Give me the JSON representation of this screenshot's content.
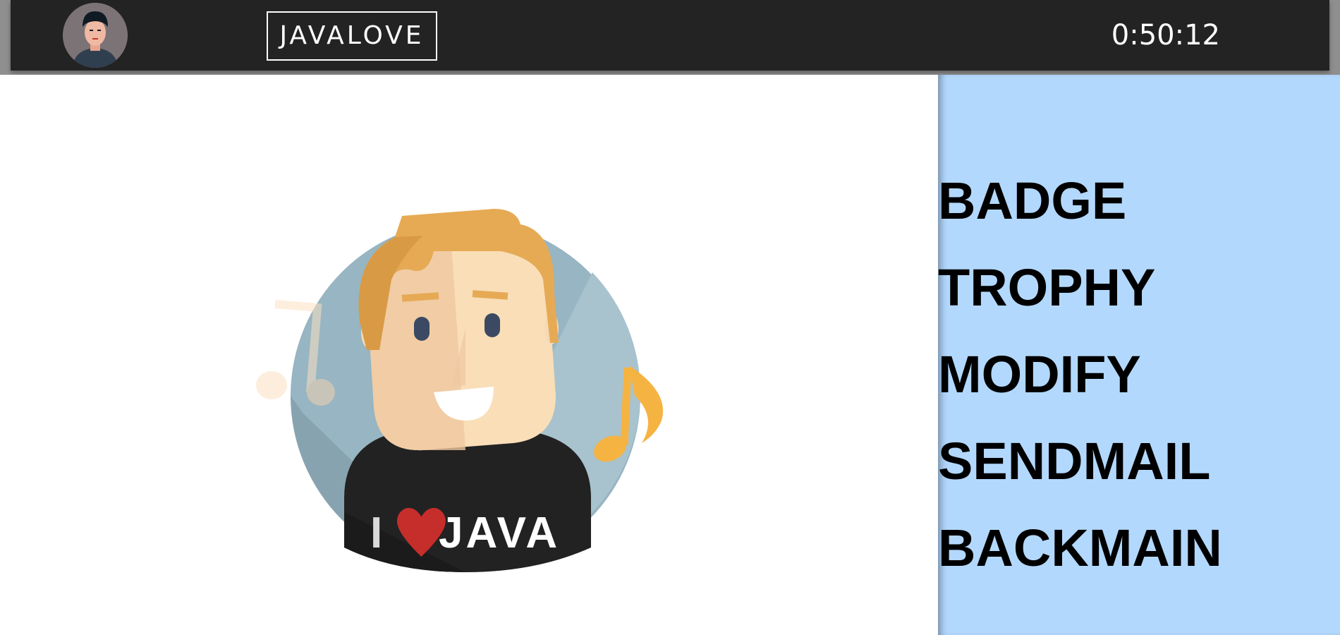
{
  "header": {
    "brand": "JAVALOVE",
    "timer": "0:50:12",
    "avatar_icon": "user-avatar-icon"
  },
  "hero": {
    "shirt_text_left": "I",
    "shirt_text_right": "JAVA",
    "icons": [
      "java-lover-illustration",
      "music-note-icon",
      "heart-icon"
    ]
  },
  "sidebar": {
    "items": [
      {
        "label": "BADGE"
      },
      {
        "label": "TROPHY"
      },
      {
        "label": "MODIFY"
      },
      {
        "label": "SENDMAIL"
      },
      {
        "label": "BACKMAIN"
      }
    ]
  },
  "colors": {
    "topbar": "#232323",
    "sidebar": "#b3d8fd",
    "hair": "#e6aa55",
    "note": "#f5b342",
    "heart": "#c62e2b"
  }
}
